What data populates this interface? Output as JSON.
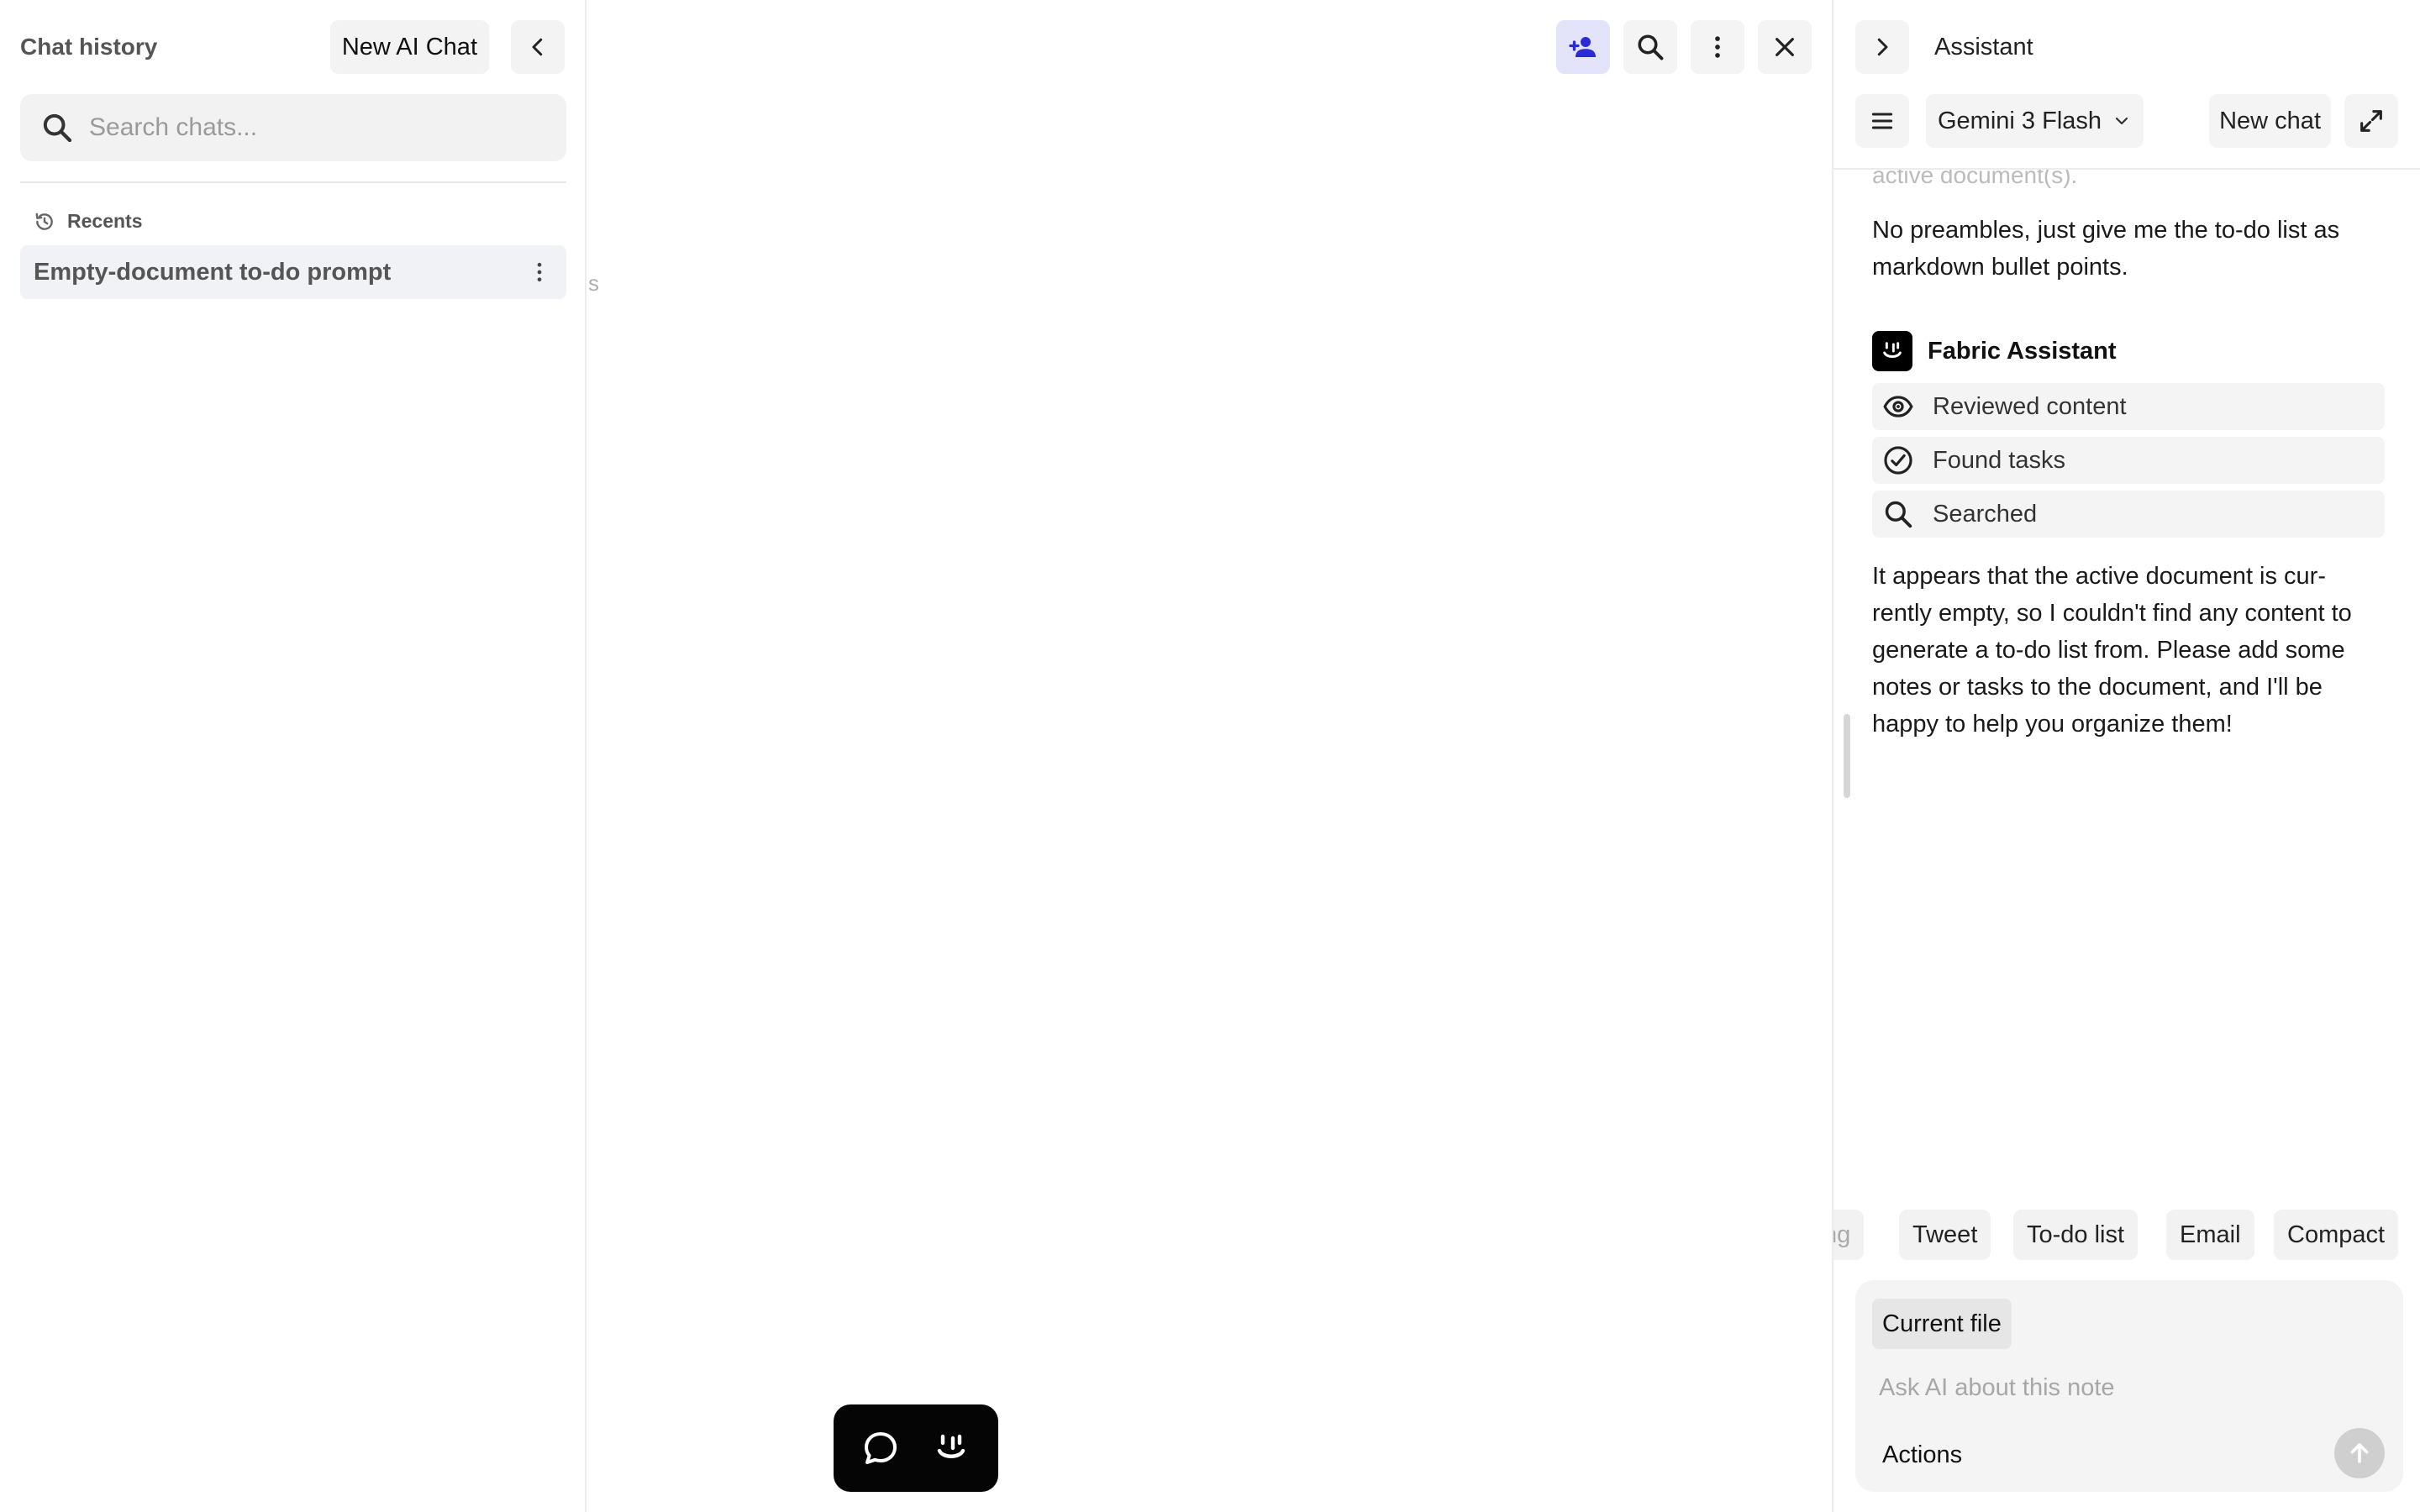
{
  "sidebar": {
    "title": "Chat history",
    "new_chat_label": "New AI Chat",
    "search": {
      "placeholder": "Search chats...",
      "value": ""
    },
    "recents_label": "Recents",
    "items": [
      {
        "label": "Empty-document to-do prompt"
      }
    ]
  },
  "main": {
    "edge_fragment": "s"
  },
  "assistant": {
    "title": "Assistant",
    "model": "Gemini 3 Flash",
    "new_chat_label": "New chat",
    "conversation": {
      "faded_prefix": "active document(s).",
      "user_message": "No preambles, just give me the to-do list as markdown bullet points.",
      "bot_name": "Fabric Assistant",
      "steps": [
        {
          "label": "Reviewed content",
          "icon": "eye-icon"
        },
        {
          "label": "Found tasks",
          "icon": "check-circle-icon"
        },
        {
          "label": "Searched",
          "icon": "search-icon"
        }
      ],
      "bot_message": "It appears that the active document is cur-rently empty, so I couldn't find any content to generate a to-do list from. Please add some notes or tasks to the document, and I'll be happy to help you organize them!"
    },
    "chips": [
      {
        "label": "ng",
        "truncated": true
      },
      {
        "label": "Tweet"
      },
      {
        "label": "To-do list"
      },
      {
        "label": "Email"
      },
      {
        "label": "Compact"
      }
    ],
    "composer": {
      "context_chip": "Current file",
      "placeholder": "Ask AI about this note",
      "actions_label": "Actions"
    }
  },
  "colors": {
    "accent_active_bg": "#e3e3f9",
    "accent_icon": "#2b2bd6",
    "dock_bg": "#050505",
    "chip_bg": "#f2f2f2"
  }
}
